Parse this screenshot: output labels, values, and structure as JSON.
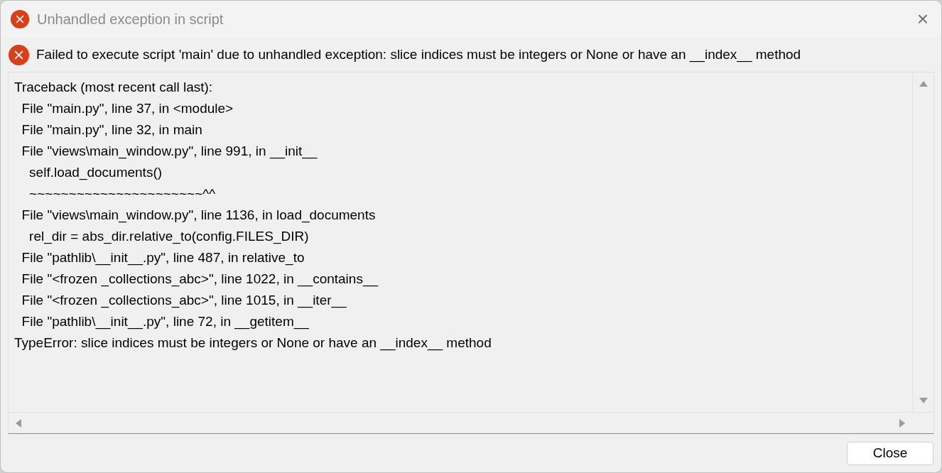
{
  "window": {
    "title": "Unhandled exception in script",
    "close": "×"
  },
  "message": "Failed to execute script 'main' due to unhandled exception: slice indices must be integers or None or have an __index__ method",
  "traceback": [
    "Traceback (most recent call last):",
    "  File \"main.py\", line 37, in <module>",
    "  File \"main.py\", line 32, in main",
    "  File \"views\\main_window.py\", line 991, in __init__",
    "    self.load_documents()",
    "    ~~~~~~~~~~~~~~~~~~~~~~^^",
    "  File \"views\\main_window.py\", line 1136, in load_documents",
    "    rel_dir = abs_dir.relative_to(config.FILES_DIR)",
    "  File \"pathlib\\__init__.py\", line 487, in relative_to",
    "  File \"<frozen _collections_abc>\", line 1022, in __contains__",
    "  File \"<frozen _collections_abc>\", line 1015, in __iter__",
    "  File \"pathlib\\__init__.py\", line 72, in __getitem__",
    "TypeError: slice indices must be integers or None or have an __index__ method"
  ],
  "buttons": [
    "Close"
  ]
}
